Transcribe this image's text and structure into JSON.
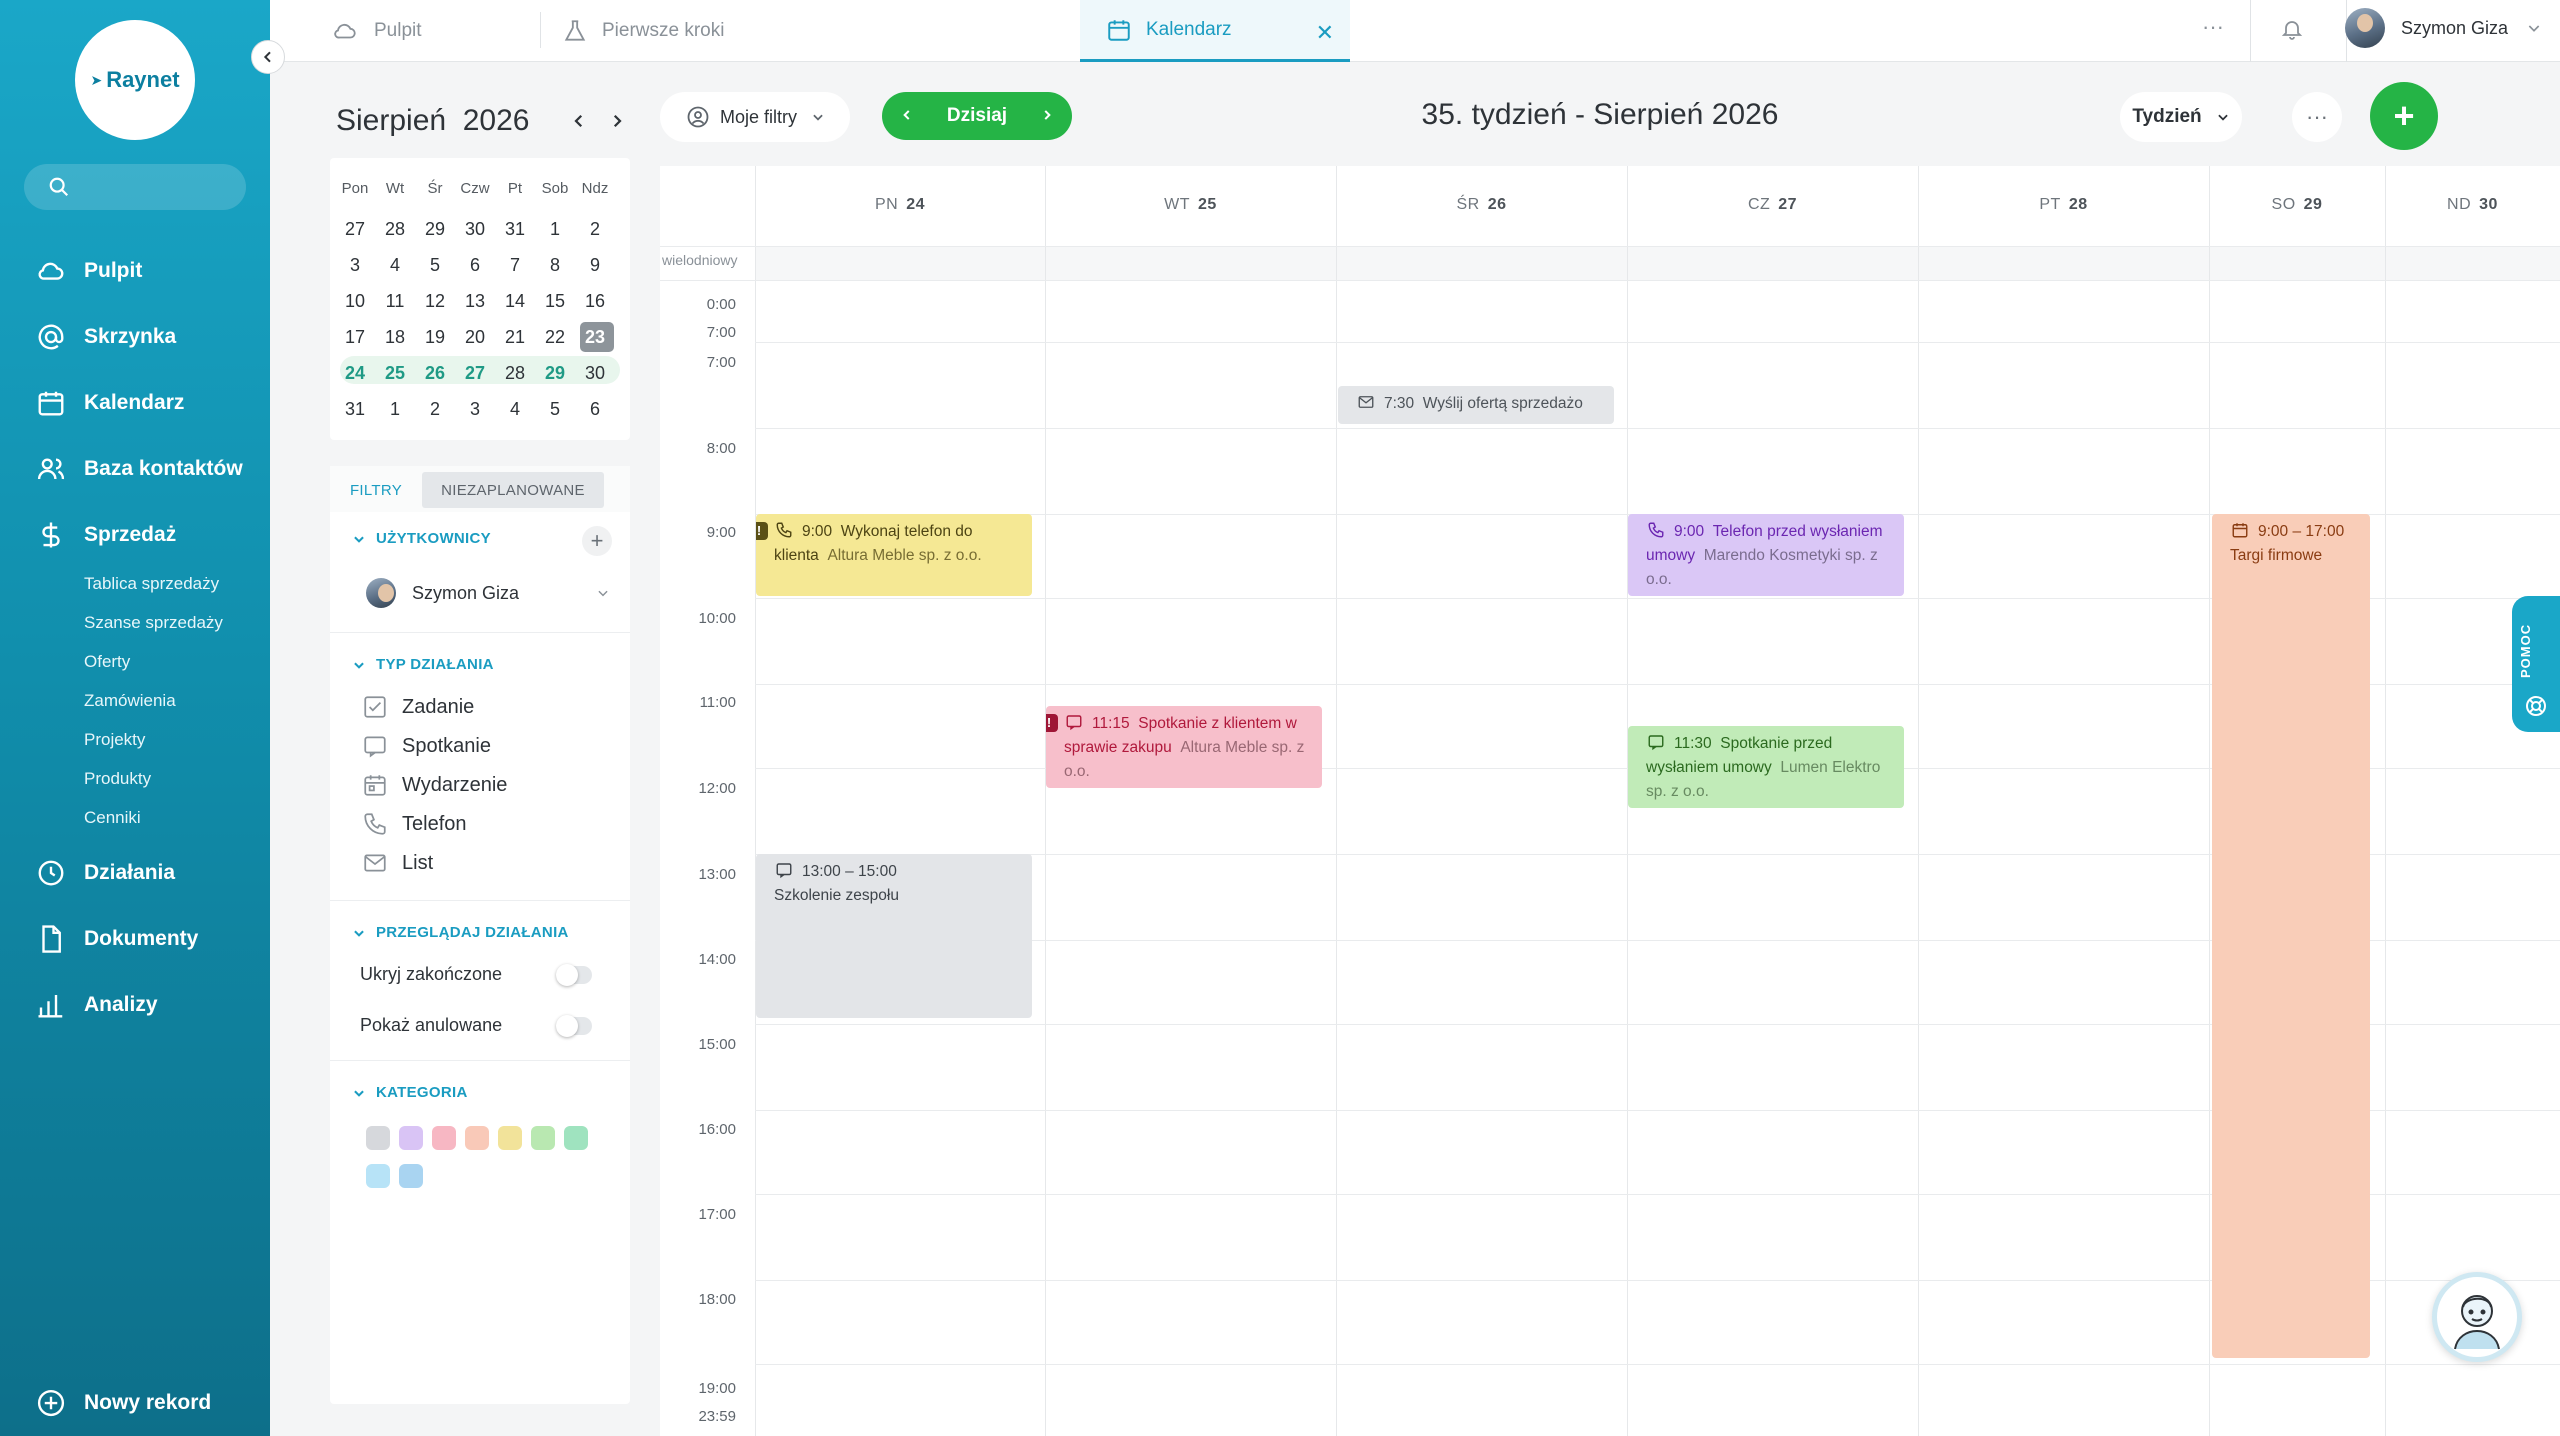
{
  "app": {
    "name": "Raynet"
  },
  "sidebar": {
    "items": [
      {
        "label": "Pulpit",
        "icon": "cloud-icon"
      },
      {
        "label": "Skrzynka",
        "icon": "at-icon"
      },
      {
        "label": "Kalendarz",
        "icon": "calendar-icon"
      },
      {
        "label": "Baza kontaktów",
        "icon": "contacts-icon"
      },
      {
        "label": "Sprzedaż",
        "icon": "dollar-icon"
      },
      {
        "label": "Działania",
        "icon": "clock-icon"
      },
      {
        "label": "Dokumenty",
        "icon": "document-icon"
      },
      {
        "label": "Analizy",
        "icon": "bar-chart-icon"
      }
    ],
    "sales_sub": [
      "Tablica sprzedaży",
      "Szanse sprzedaży",
      "Oferty",
      "Zamówienia",
      "Projekty",
      "Produkty",
      "Cenniki"
    ],
    "new_record": "Nowy rekord"
  },
  "topbar": {
    "tabs": [
      "Pulpit",
      "Pierwsze kroki",
      "Kalendarz"
    ],
    "user": "Szymon Giza"
  },
  "minical": {
    "month": "Sierpień",
    "year": "2026",
    "weekdays": [
      "Pon",
      "Wt",
      "Śr",
      "Czw",
      "Pt",
      "Sob",
      "Ndz"
    ],
    "weeks": [
      [
        "27",
        "28",
        "29",
        "30",
        "31",
        "1",
        "2"
      ],
      [
        "3",
        "4",
        "5",
        "6",
        "7",
        "8",
        "9"
      ],
      [
        "10",
        "11",
        "12",
        "13",
        "14",
        "15",
        "16"
      ],
      [
        "17",
        "18",
        "19",
        "20",
        "21",
        "22",
        "23"
      ],
      [
        "24",
        "25",
        "26",
        "27",
        "28",
        "29",
        "30"
      ],
      [
        "31",
        "1",
        "2",
        "3",
        "4",
        "5",
        "6"
      ]
    ],
    "today": "23"
  },
  "filters": {
    "tab_filters": "FILTRY",
    "tab_unplanned": "NIEZAPLANOWANE",
    "users_title": "UŻYTKOWNICY",
    "user": "Szymon Giza",
    "type_title": "TYP DZIAŁANIA",
    "types": [
      "Zadanie",
      "Spotkanie",
      "Wydarzenie",
      "Telefon",
      "List"
    ],
    "browse_title": "PRZEGLĄDAJ DZIAŁANIA",
    "hide_done": "Ukryj zakończone",
    "show_cancelled": "Pokaż anulowane",
    "category_title": "KATEGORIA",
    "category_colors": [
      "#d6d8dc",
      "#d9c4f5",
      "#f7b7c3",
      "#f9c9b8",
      "#f2e39a",
      "#b9e8b1",
      "#9fe3bf",
      "#b7e3f7",
      "#a9d4f1"
    ]
  },
  "toolbar": {
    "my_filters": "Moje filtry",
    "today": "Dzisiaj",
    "title": "35. tydzień - Sierpień 2026",
    "view": "Tydzień"
  },
  "week": {
    "days": [
      {
        "name": "PN",
        "num": "24"
      },
      {
        "name": "WT",
        "num": "25"
      },
      {
        "name": "ŚR",
        "num": "26"
      },
      {
        "name": "CZ",
        "num": "27"
      },
      {
        "name": "PT",
        "num": "28"
      },
      {
        "name": "SO",
        "num": "29"
      },
      {
        "name": "ND",
        "num": "30"
      }
    ],
    "allday_label": "wielodniowy",
    "hours": [
      "0:00",
      "7:00",
      "7:00",
      "8:00",
      "9:00",
      "10:00",
      "11:00",
      "12:00",
      "13:00",
      "14:00",
      "15:00",
      "16:00",
      "17:00",
      "18:00",
      "19:00",
      "23:59"
    ]
  },
  "events": [
    {
      "time": "7:30",
      "title": "Wyślij ofertą sprzedażo",
      "company": ""
    },
    {
      "time": "9:00",
      "title": "Wykonaj telefon do klienta",
      "company": "Altura Meble sp. z o.o."
    },
    {
      "time": "9:00",
      "title": "Telefon przed wysłaniem umowy",
      "company": "Marendo Kosmetyki sp. z o.o."
    },
    {
      "time": "9:00 – 17:00",
      "title": "Targi firmowe",
      "company": ""
    },
    {
      "time": "11:15",
      "title": "Spotkanie z klientem w sprawie zakupu",
      "company": "Altura Meble sp. z o.o."
    },
    {
      "time": "11:30",
      "title": "Spotkanie przed wysłaniem umowy",
      "company": "Lumen Elektro sp. z o.o."
    },
    {
      "time": "13:00 – 15:00",
      "title": "Szkolenie zespołu",
      "company": ""
    }
  ],
  "help": {
    "label": "POMOC"
  }
}
